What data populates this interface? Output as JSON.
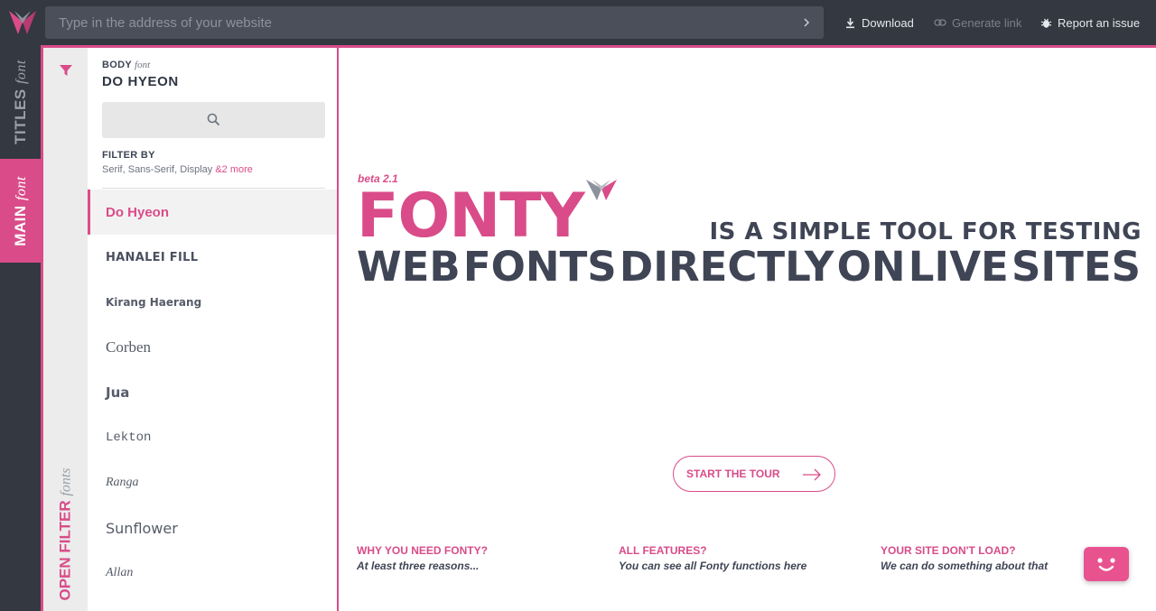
{
  "colors": {
    "accent": "#d94c89",
    "topbar": "#343841",
    "text_dark": "#3f4555"
  },
  "topbar": {
    "address_placeholder": "Type in the address of your website",
    "download_label": "Download",
    "generate_link_label": "Generate link",
    "report_issue_label": "Report an issue",
    "icons": [
      "fonty-logo",
      "chevron-right-icon",
      "download-icon",
      "link-icon",
      "bug-icon"
    ]
  },
  "rail": {
    "titles_bold": "TITLES",
    "titles_italic": "font",
    "main_bold": "MAIN",
    "main_italic": "font"
  },
  "filter_strip": {
    "open_label": "OPEN",
    "filter_label": "FILTER",
    "fonts_label": "fonts"
  },
  "panel": {
    "body_label": "BODY",
    "body_label_italic": "font",
    "current_font": "DO HYEON",
    "filter_by_label": "FILTER BY",
    "filter_values": "Serif, Sans-Serif, Display",
    "filter_more": "&2 more",
    "fonts": [
      "Do Hyeon",
      "HANALEI FILL",
      "Kirang Haerang",
      "Corben",
      "Jua",
      "Lekton",
      "Ranga",
      "Sunflower",
      "Allan"
    ]
  },
  "hero": {
    "beta": "beta 2.1",
    "title": "FONTY",
    "line1": "IS A SIMPLE TOOL FOR TESTING",
    "line2_words": [
      "WEB",
      "FONTS",
      "DIRECTLY",
      "ON",
      "LIVE",
      "SITES"
    ]
  },
  "tour_button": "START THE TOUR",
  "features": [
    {
      "title": "WHY YOU NEED FONTY?",
      "subtitle": "At least three reasons..."
    },
    {
      "title": "ALL FEATURES?",
      "subtitle": "You can see all Fonty functions here"
    },
    {
      "title": "YOUR SITE DON'T LOAD?",
      "subtitle": "We can do something about that"
    }
  ]
}
